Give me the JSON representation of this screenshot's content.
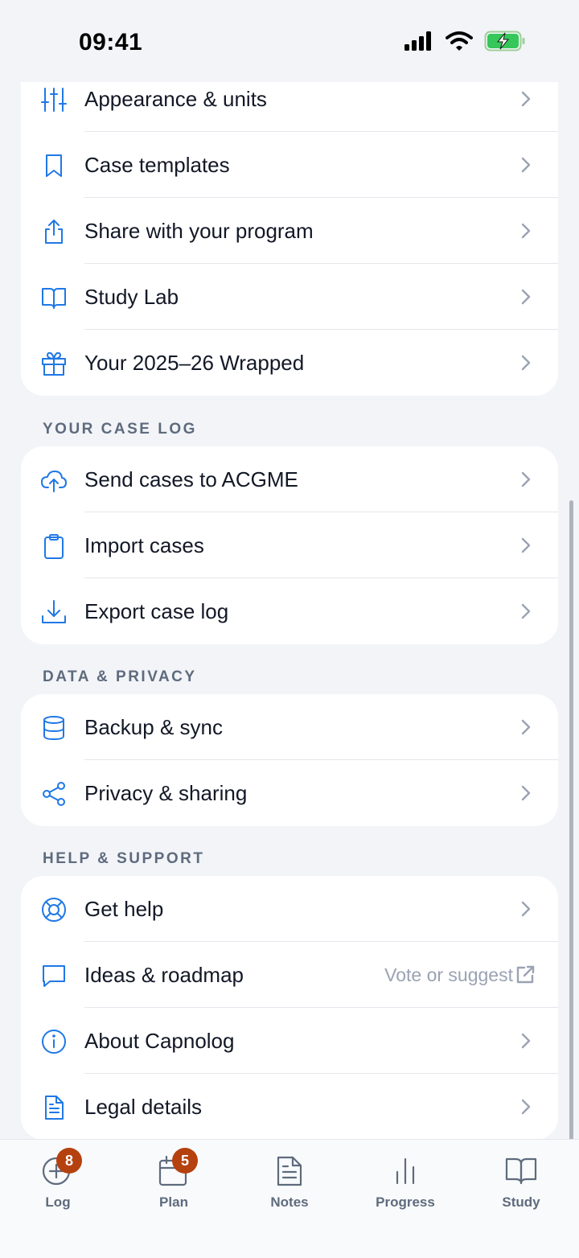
{
  "status": {
    "time": "09:41"
  },
  "sections": {
    "general": {
      "items": [
        {
          "label": "Appearance & units",
          "icon": "sliders-icon"
        },
        {
          "label": "Case templates",
          "icon": "bookmark-icon"
        },
        {
          "label": "Share with your program",
          "icon": "share-icon"
        },
        {
          "label": "Study Lab",
          "icon": "book-icon"
        },
        {
          "label": "Your 2025–26 Wrapped",
          "icon": "gift-icon"
        }
      ]
    },
    "case_log": {
      "title": "YOUR CASE LOG",
      "items": [
        {
          "label": "Send cases to ACGME",
          "icon": "cloud-upload-icon"
        },
        {
          "label": "Import cases",
          "icon": "clipboard-icon"
        },
        {
          "label": "Export case log",
          "icon": "download-icon"
        }
      ]
    },
    "data_privacy": {
      "title": "DATA & PRIVACY",
      "items": [
        {
          "label": "Backup & sync",
          "icon": "database-icon"
        },
        {
          "label": "Privacy & sharing",
          "icon": "share-nodes-icon"
        }
      ]
    },
    "help": {
      "title": "HELP & SUPPORT",
      "items": [
        {
          "label": "Get help",
          "icon": "lifebuoy-icon"
        },
        {
          "label": "Ideas & roadmap",
          "icon": "message-icon",
          "sub": "Vote or suggest"
        },
        {
          "label": "About Capnolog",
          "icon": "info-icon"
        },
        {
          "label": "Legal details",
          "icon": "document-icon"
        }
      ]
    }
  },
  "tabbar": {
    "tabs": [
      {
        "label": "Log",
        "badge": "8",
        "icon": "plus-circle-icon"
      },
      {
        "label": "Plan",
        "badge": "5",
        "icon": "calendar-icon"
      },
      {
        "label": "Notes",
        "icon": "notes-icon"
      },
      {
        "label": "Progress",
        "icon": "bar-chart-icon"
      },
      {
        "label": "Study",
        "icon": "book-open-icon"
      }
    ]
  },
  "colors": {
    "accent": "#1f78e6",
    "badge": "#b5410f",
    "background": "#f2f4f8"
  }
}
